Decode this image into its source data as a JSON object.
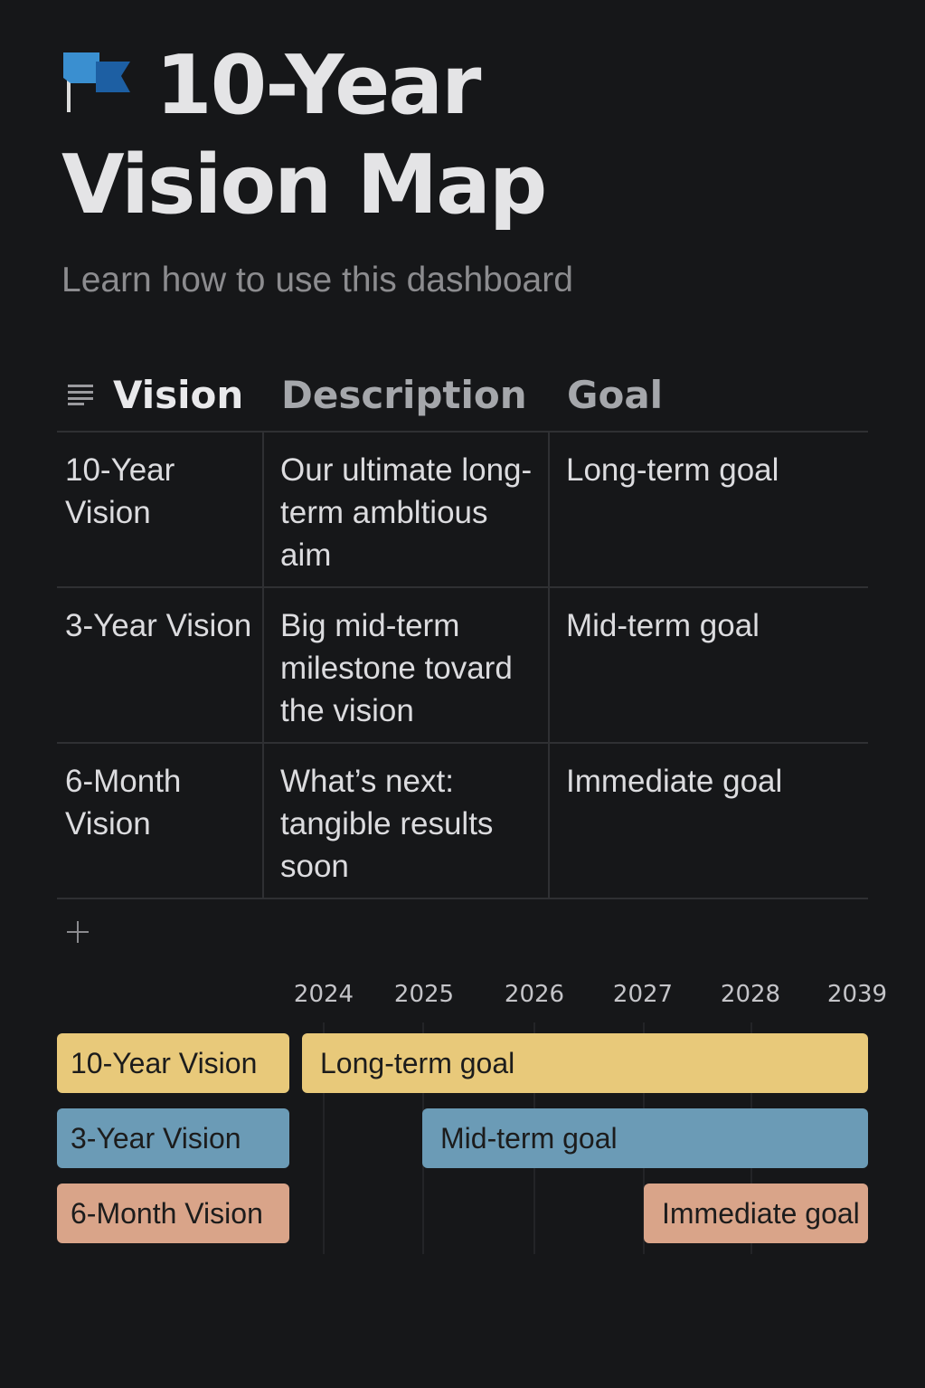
{
  "page": {
    "title_line1": "10-Year",
    "title_line2": "Vision Map",
    "subtitle": "Learn how to use this dashboard",
    "title_icon": "flag-icon"
  },
  "table": {
    "header_icon": "list-icon",
    "columns": [
      "Vision",
      "Description",
      "Goal"
    ],
    "rows": [
      {
        "vision": "10-Year Vision",
        "description": "Our ultimate long-term ambltious aim",
        "goal": "Long-term goal"
      },
      {
        "vision": "3-Year Vision",
        "description": "Big mid-term milestone tovard the vision",
        "goal": "Mid-term goal"
      },
      {
        "vision": "6-Month Vision",
        "description": "What’s next: tangible results soon",
        "goal": "Immediate goal"
      }
    ],
    "add_icon": "plus-icon"
  },
  "timeline": {
    "years": [
      "2024",
      "2025",
      "2026",
      "2027",
      "2028",
      "2039"
    ],
    "items": [
      {
        "name": "10-Year Vision",
        "goal": "Long-term goal",
        "start": "2024",
        "color": "#e8c97a"
      },
      {
        "name": "3-Year Vision",
        "goal": "Mid-term goal",
        "start": "2025",
        "color": "#6b9bb6"
      },
      {
        "name": "6-Month Vision",
        "goal": "Immediate goal",
        "start": "2027",
        "color": "#d9a489"
      }
    ]
  }
}
